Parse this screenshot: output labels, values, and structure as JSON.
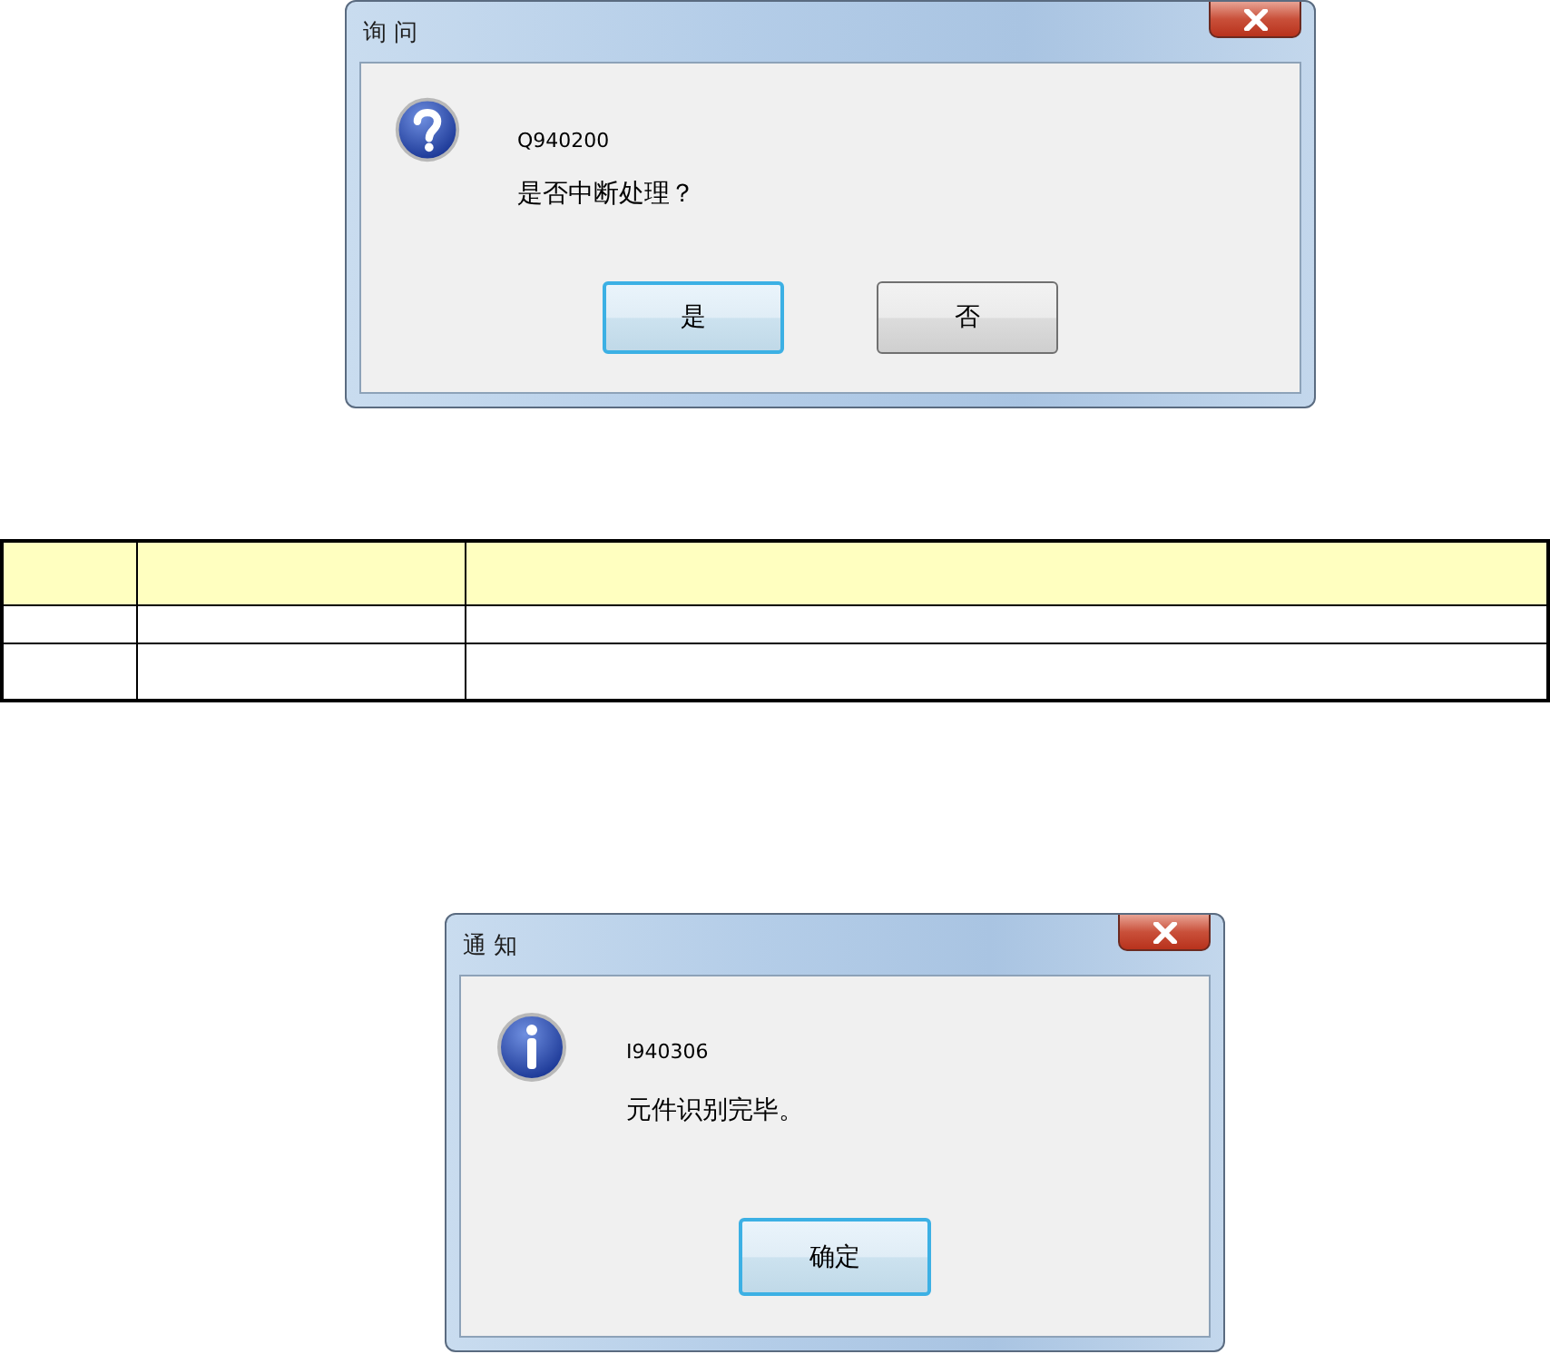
{
  "dialogs": [
    {
      "kind": "question",
      "title": "询 问",
      "code": "Q940200",
      "message": "是否中断处理？",
      "buttons": [
        {
          "label": "是",
          "selected": true
        },
        {
          "label": "否",
          "selected": false
        }
      ]
    },
    {
      "kind": "info",
      "title": "通 知",
      "code": "I940306",
      "message": "元件识别完毕。",
      "buttons": [
        {
          "label": "确定",
          "selected": true
        }
      ]
    }
  ]
}
